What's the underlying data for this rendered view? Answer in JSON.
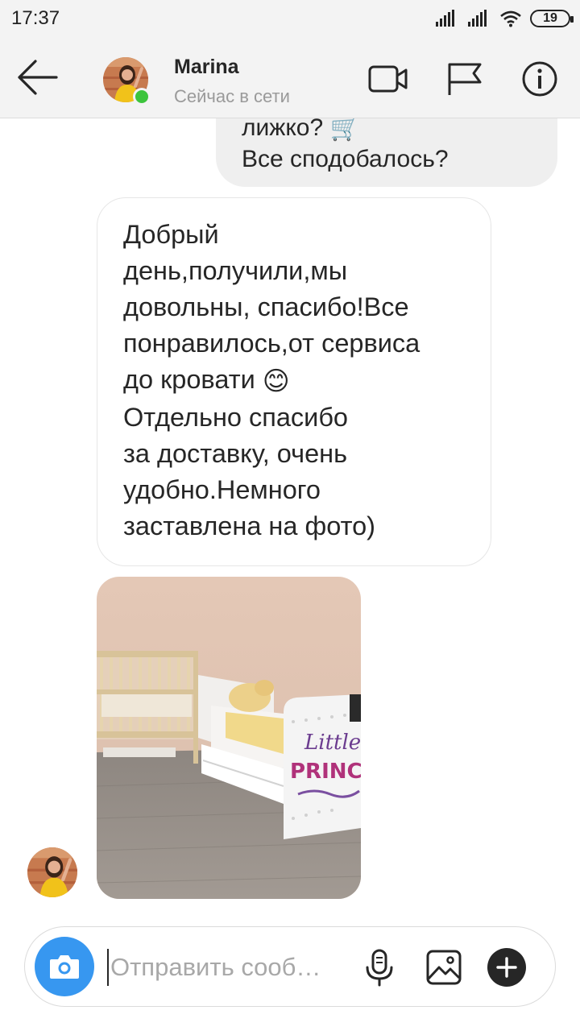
{
  "status_bar": {
    "time": "17:37",
    "battery": "19"
  },
  "header": {
    "name": "Marina",
    "status": "Сейчас в сети",
    "online_color": "#3cc43c",
    "icons": [
      "back-arrow-icon",
      "video-call-icon",
      "flag-icon",
      "info-icon"
    ]
  },
  "messages": {
    "sent": {
      "line1": "лижко?",
      "line1_emoji": "🛒",
      "line2": "Все сподобалось?"
    },
    "received": {
      "lines": [
        "Добрый",
        "день,получили,мы",
        "довольны, спасибо!Все",
        "понравилось,от сервиса",
        "до кровати",
        "Отдельно спасибо",
        "за доставку, очень",
        "удобно.Немного",
        "заставлена на фото)"
      ],
      "emoji": "😊"
    },
    "photo": {
      "sign_line1": "Little",
      "sign_line2": "PRINCESS"
    }
  },
  "composer": {
    "placeholder": "Отправить сооб…",
    "accent": "#3797f0",
    "icons": [
      "camera-icon",
      "microphone-icon",
      "gallery-icon",
      "add-icon"
    ]
  }
}
